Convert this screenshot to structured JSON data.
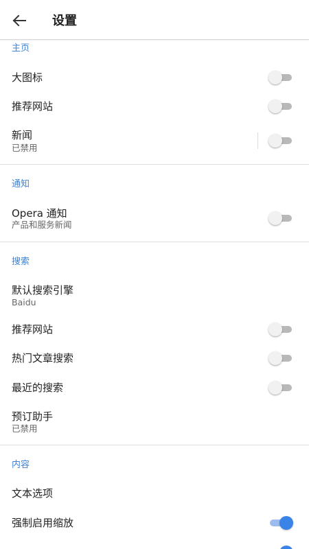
{
  "appbar": {
    "title": "设置"
  },
  "sections": {
    "home": {
      "header": "主页",
      "big_icons": {
        "label": "大图标",
        "on": false
      },
      "recommended_sites": {
        "label": "推荐网站",
        "on": false
      },
      "news": {
        "label": "新闻",
        "sub": "已禁用",
        "on": false
      }
    },
    "notifications": {
      "header": "通知",
      "opera_notify": {
        "label": "Opera 通知",
        "sub": "产品和服务新闻",
        "on": false
      }
    },
    "search": {
      "header": "搜索",
      "default_engine": {
        "label": "默认搜索引擎",
        "sub": "Baidu"
      },
      "recommended_sites": {
        "label": "推荐网站",
        "on": false
      },
      "trending_search": {
        "label": "热门文章搜索",
        "on": false
      },
      "recent_search": {
        "label": "最近的搜索",
        "on": false
      },
      "booking_assistant": {
        "label": "预订助手",
        "sub": "已禁用"
      }
    },
    "content": {
      "header": "内容",
      "text_options": {
        "label": "文本选项"
      },
      "force_zoom": {
        "label": "强制启用缩放",
        "on": true
      },
      "partial_row": {
        "on": true
      }
    }
  },
  "colors": {
    "accent": "#3d82d6",
    "toggle_on": "#3a84e8",
    "toggle_off_track": "#b9b9b9"
  }
}
